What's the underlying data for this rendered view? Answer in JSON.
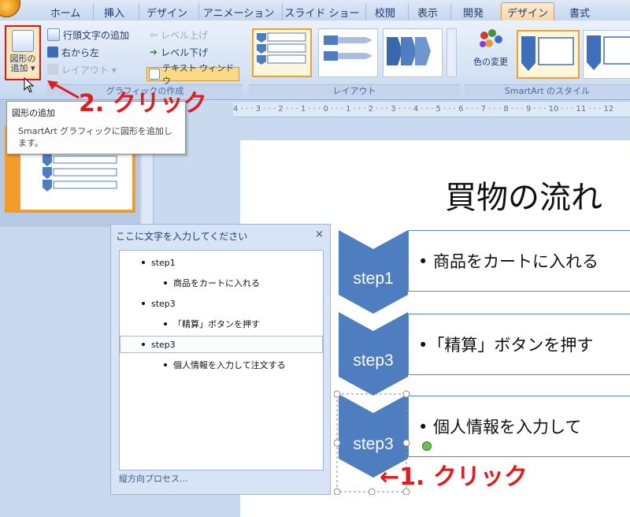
{
  "tabs": [
    "ホーム",
    "挿入",
    "デザイン",
    "アニメーション",
    "スライド ショー",
    "校閲",
    "表示",
    "開発",
    "デザイン",
    "書式"
  ],
  "active_tab": "デザイン",
  "ribbon": {
    "add_shape_label": "図形の追加 ▾",
    "add_bullet": "行頭文字の追加",
    "right_to_left": "右から左",
    "layout": "レイアウト ▾",
    "promote": "レベル上げ",
    "demote": "レベル下げ",
    "text_window": "テキスト ウィンドウ",
    "group_create": "グラフィックの作成",
    "group_layout": "レイアウト",
    "change_colors": "色の変更",
    "group_styles": "SmartArt のスタイル"
  },
  "ruler_text": "4 · · · 3 · · · 2 · · · 1 · · · 0 · · · 1 · · · 2 · · · 3 · · · 4 · · · 5 · · · 6 · · · 7 · · · 8 · · · 9 · · · 10 · · · 11 · · · 12",
  "tooltip": {
    "title": "図形の追加",
    "description": "SmartArt グラフィックに図形を追加します。"
  },
  "slide": {
    "title": "買物の流れ",
    "steps": [
      {
        "label": "step1",
        "text": "• 商品をカートに入れる"
      },
      {
        "label": "step3",
        "text": "•「精算」ボタンを押す"
      },
      {
        "label": "step3",
        "text": "• 個人情報を入力して"
      }
    ]
  },
  "text_pane": {
    "title": "ここに文字を入力してください",
    "close": "×",
    "items": [
      {
        "level": 1,
        "text": "step1"
      },
      {
        "level": 2,
        "text": "商品をカートに入れる"
      },
      {
        "level": 1,
        "text": "step3"
      },
      {
        "level": 2,
        "text": "「精算」ボタンを押す"
      },
      {
        "level": 1,
        "text": "step3"
      },
      {
        "level": 2,
        "text": "個人情報を入力して注文する"
      }
    ],
    "footer": "縦方向プロセス..."
  },
  "annotations": {
    "click1": "←1. クリック",
    "click2": "2. クリック"
  },
  "colors": {
    "chevron": "#4f7ec0",
    "annotation": "#e31b1b",
    "highlight": "#f0a030"
  }
}
